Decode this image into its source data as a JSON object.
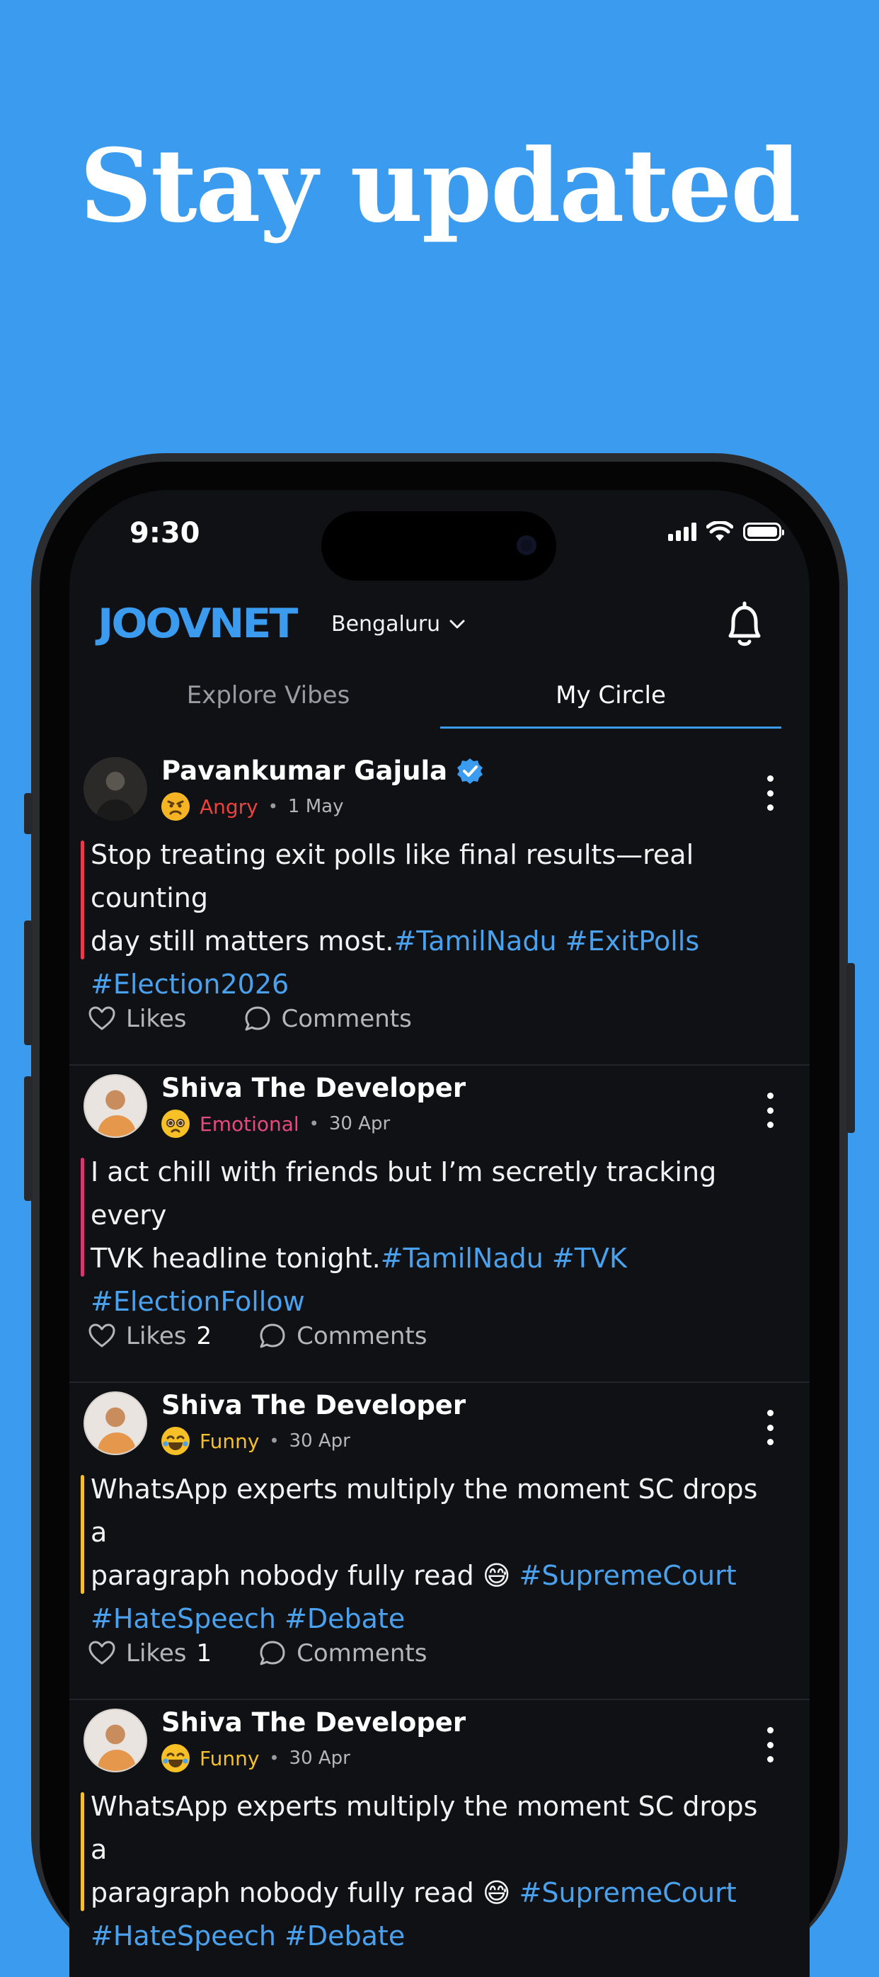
{
  "headline": "Stay updated",
  "status_bar": {
    "time": "9:30"
  },
  "app": {
    "logo": "JOOVNET",
    "location": "Bengaluru",
    "tabs": [
      {
        "label": "Explore Vibes",
        "active": false
      },
      {
        "label": "My Circle",
        "active": true
      }
    ]
  },
  "colors": {
    "accent": "#3a9bef",
    "background": "#0f1115",
    "angry": "#f0413c",
    "emotional": "#e9497d",
    "funny": "#f6c026"
  },
  "posts": [
    {
      "author": "Pavankumar Gajula",
      "verified": true,
      "mood": "Angry",
      "mood_emoji": "angry-face-icon",
      "date": "1 May",
      "text_line1": "Stop treating exit polls like final results—real counting",
      "text_line2": "day still matters most.",
      "tags_line2": "#TamilNadu #ExitPolls",
      "tags_line3": "#Election2026",
      "likes_label": "Likes",
      "likes_count": "",
      "comments_label": "Comments"
    },
    {
      "author": "Shiva The Developer",
      "verified": false,
      "mood": "Emotional",
      "mood_emoji": "pleading-face-icon",
      "date": "30 Apr",
      "text_line1": "I act chill with friends but I’m secretly tracking every",
      "text_line2": "TVK headline tonight.",
      "tags_line2": "#TamilNadu #TVK",
      "tags_line3": "#ElectionFollow",
      "likes_label": "Likes",
      "likes_count": "2",
      "comments_label": "Comments"
    },
    {
      "author": "Shiva The Developer",
      "verified": false,
      "mood": "Funny",
      "mood_emoji": "laughing-face-icon",
      "date": "30 Apr",
      "text_line1": "WhatsApp experts multiply the moment SC drops a",
      "text_line2": "paragraph nobody fully read 😅 ",
      "tags_line2": "#SupremeCourt",
      "tags_line3": "#HateSpeech #Debate",
      "likes_label": "Likes",
      "likes_count": "1",
      "comments_label": "Comments"
    },
    {
      "author": "Shiva The Developer",
      "verified": false,
      "mood": "Funny",
      "mood_emoji": "laughing-face-icon",
      "date": "30 Apr",
      "text_line1": "WhatsApp experts multiply the moment SC drops a",
      "text_line2": "paragraph nobody fully read 😅 ",
      "tags_line2": "#SupremeCourt",
      "tags_line3": "#HateSpeech #Debate",
      "likes_label": "Likes",
      "likes_count": "",
      "comments_label": "Comments"
    }
  ]
}
